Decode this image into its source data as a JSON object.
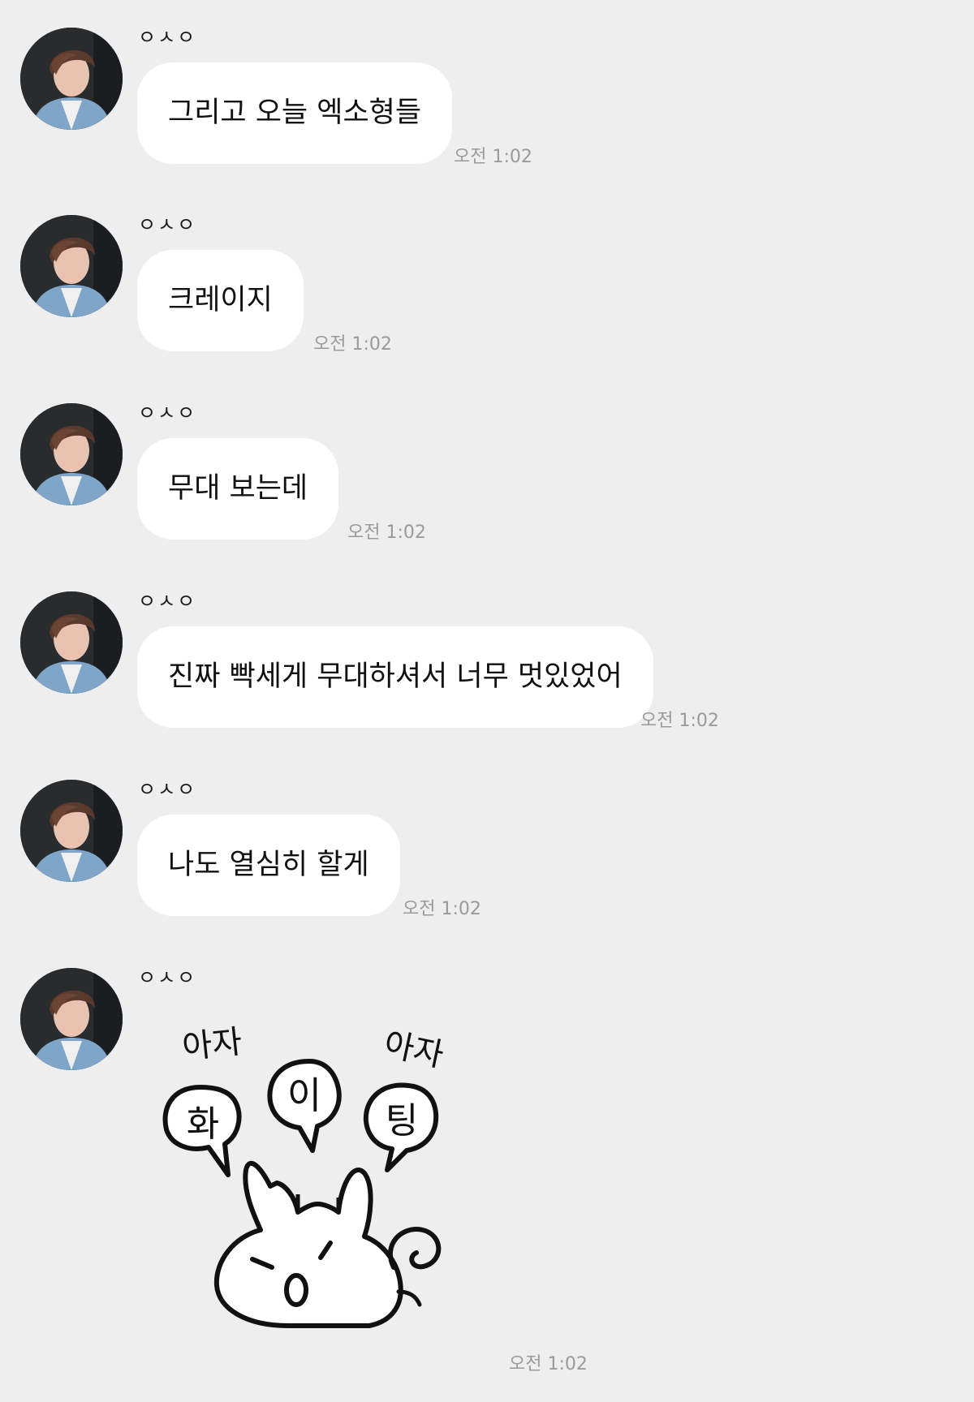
{
  "messages": [
    {
      "sender": "ㅇㅅㅇ",
      "text": "그리고 오늘 엑소형들",
      "time": "오전 1:02"
    },
    {
      "sender": "ㅇㅅㅇ",
      "text": "크레이지",
      "time": "오전 1:02"
    },
    {
      "sender": "ㅇㅅㅇ",
      "text": "무대 보는데",
      "time": "오전 1:02"
    },
    {
      "sender": "ㅇㅅㅇ",
      "text": "진짜 빡세게 무대하셔서 너무 멋있었어",
      "time": "오전 1:02"
    },
    {
      "sender": "ㅇㅅㅇ",
      "text": "나도 열심히 할게",
      "time": "오전 1:02"
    }
  ],
  "sticker_message": {
    "sender": "ㅇㅅㅇ",
    "time": "오전 1:02",
    "sticker_text": {
      "left_top": "아자",
      "right_top": "아자",
      "bubble_1": "화",
      "bubble_2": "이",
      "bubble_3": "팅"
    },
    "icon": "bunny-sticker"
  },
  "colors": {
    "background": "#eeeeee",
    "bubble": "#ffffff",
    "time_text": "#9a9a9a"
  }
}
